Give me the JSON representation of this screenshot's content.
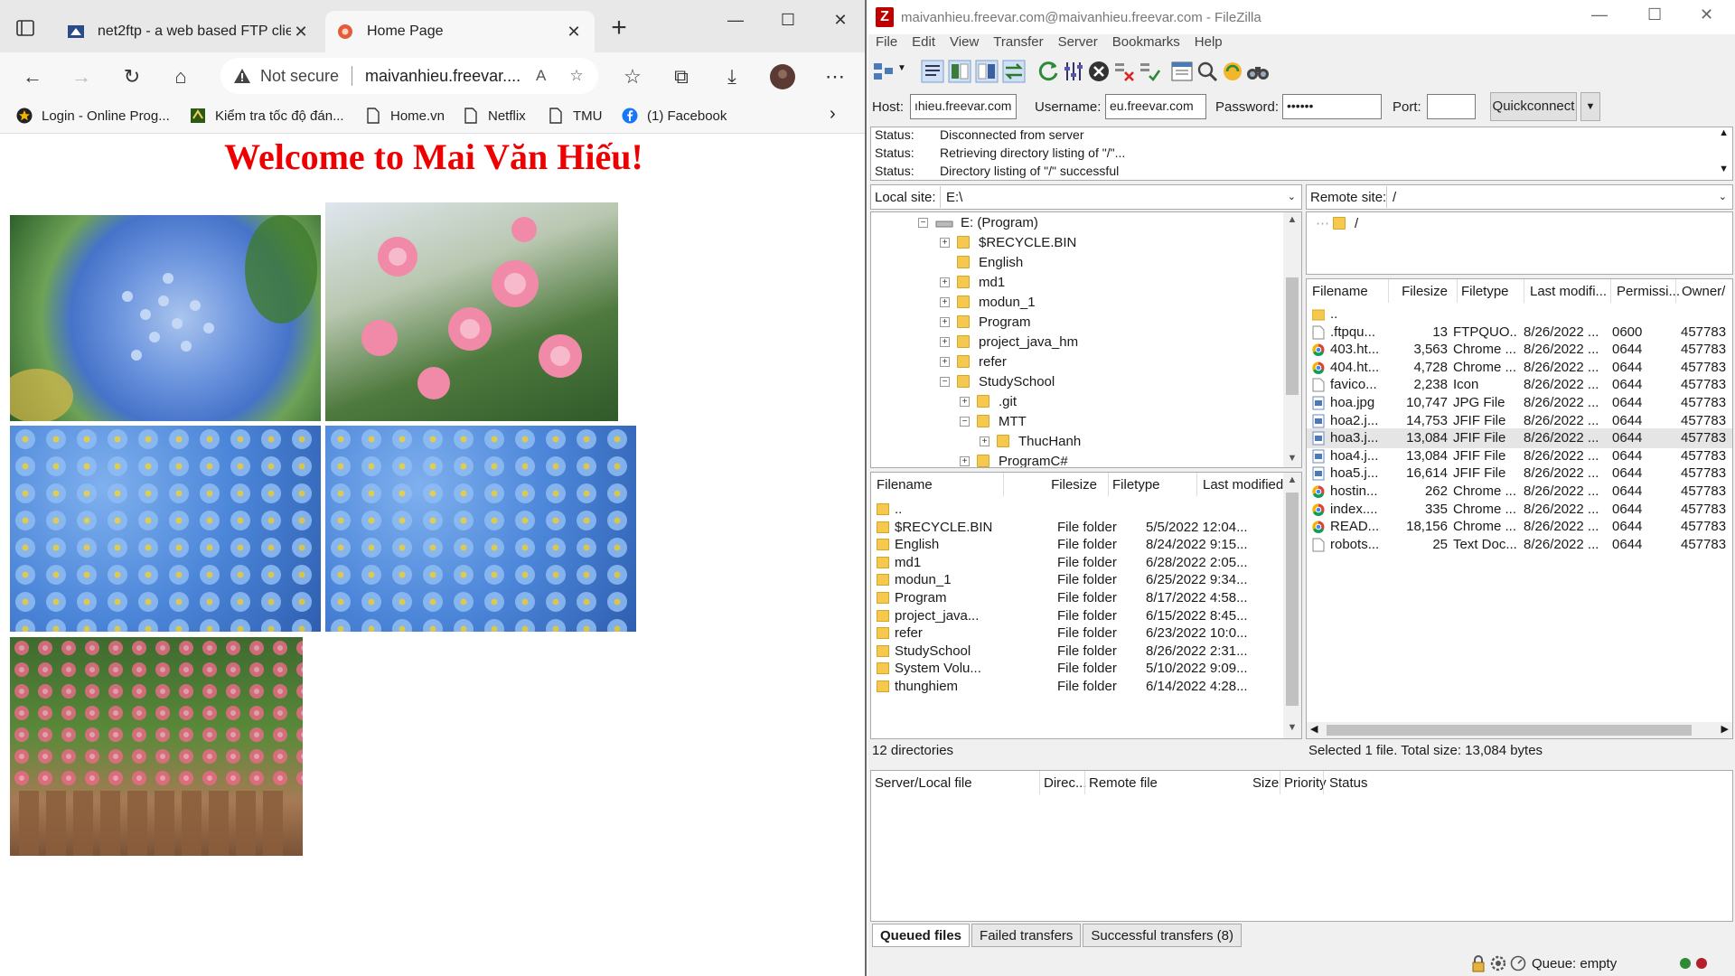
{
  "browser": {
    "tabs": [
      {
        "title": "net2ftp - a web based FTP client"
      },
      {
        "title": "Home Page"
      }
    ],
    "address": {
      "security": "Not secure",
      "url": "maivanhieu.freevar...."
    },
    "bookmarks": [
      {
        "label": "Login - Online Prog..."
      },
      {
        "label": "Kiểm tra tốc độ đán..."
      },
      {
        "label": "Home.vn"
      },
      {
        "label": "Netflix"
      },
      {
        "label": "TMU"
      },
      {
        "label": "(1) Facebook"
      }
    ],
    "page": {
      "heading": "Welcome to Mai Văn Hiếu!",
      "photos": [
        "hydrangea",
        "pink-roses",
        "forget-me-nots",
        "forget-me-nots",
        "climbing-roses"
      ]
    }
  },
  "filezilla": {
    "title": "maivanhieu.freevar.com@maivanhieu.freevar.com - FileZilla",
    "menu": [
      "File",
      "Edit",
      "View",
      "Transfer",
      "Server",
      "Bookmarks",
      "Help"
    ],
    "quickconnect": {
      "host_label": "Host:",
      "host_value": "ıhieu.freevar.com",
      "username_label": "Username:",
      "username_value": "eu.freevar.com",
      "password_label": "Password:",
      "password_value": "••••••",
      "port_label": "Port:",
      "port_value": "",
      "button": "Quickconnect"
    },
    "log": [
      {
        "label": "Status:",
        "msg": "Disconnected from server"
      },
      {
        "label": "Status:",
        "msg": "Retrieving directory listing of \"/\"..."
      },
      {
        "label": "Status:",
        "msg": "Directory listing of \"/\" successful"
      }
    ],
    "local_site": {
      "label": "Local site:",
      "value": "E:\\"
    },
    "remote_site": {
      "label": "Remote site:",
      "value": "/"
    },
    "local_tree": [
      {
        "label": "E: (Program)",
        "expander": "⊟"
      },
      {
        "label": "$RECYCLE.BIN",
        "expander": "+"
      },
      {
        "label": "English",
        "expander": ""
      },
      {
        "label": "md1",
        "expander": "+"
      },
      {
        "label": "modun_1",
        "expander": "+"
      },
      {
        "label": "Program",
        "expander": "+"
      },
      {
        "label": "project_java_hm",
        "expander": "+"
      },
      {
        "label": "refer",
        "expander": "+"
      },
      {
        "label": "StudySchool",
        "expander": "−"
      },
      {
        "label": ".git",
        "expander": "+"
      },
      {
        "label": "MTT",
        "expander": "−"
      },
      {
        "label": "ThucHanh",
        "expander": "+"
      },
      {
        "label": "ProgramC#",
        "expander": "+"
      }
    ],
    "remote_tree": [
      {
        "label": "/"
      }
    ],
    "local_columns": [
      "Filename",
      "Filesize",
      "Filetype",
      "Last modified"
    ],
    "local_files": [
      {
        "name": "..",
        "size": "",
        "type": "",
        "modified": ""
      },
      {
        "name": "$RECYCLE.BIN",
        "size": "",
        "type": "File folder",
        "modified": "5/5/2022 12:04..."
      },
      {
        "name": "English",
        "size": "",
        "type": "File folder",
        "modified": "8/24/2022 9:15..."
      },
      {
        "name": "md1",
        "size": "",
        "type": "File folder",
        "modified": "6/28/2022 2:05..."
      },
      {
        "name": "modun_1",
        "size": "",
        "type": "File folder",
        "modified": "6/25/2022 9:34..."
      },
      {
        "name": "Program",
        "size": "",
        "type": "File folder",
        "modified": "8/17/2022 4:58..."
      },
      {
        "name": "project_java...",
        "size": "",
        "type": "File folder",
        "modified": "6/15/2022 8:45..."
      },
      {
        "name": "refer",
        "size": "",
        "type": "File folder",
        "modified": "6/23/2022 10:0..."
      },
      {
        "name": "StudySchool",
        "size": "",
        "type": "File folder",
        "modified": "8/26/2022 2:31..."
      },
      {
        "name": "System Volu...",
        "size": "",
        "type": "File folder",
        "modified": "5/10/2022 9:09..."
      },
      {
        "name": "thunghiem",
        "size": "",
        "type": "File folder",
        "modified": "6/14/2022 4:28..."
      }
    ],
    "remote_columns": [
      "Filename",
      "Filesize",
      "Filetype",
      "Last modifi...",
      "Permissi...",
      "Owner/"
    ],
    "remote_files": [
      {
        "name": "..",
        "size": "",
        "type": "",
        "modified": "",
        "perm": "",
        "owner": "",
        "icon": "folder"
      },
      {
        "name": ".ftpqu...",
        "size": "13",
        "type": "FTPQUO...",
        "modified": "8/26/2022 ...",
        "perm": "0600",
        "owner": "457783",
        "icon": "file"
      },
      {
        "name": "403.ht...",
        "size": "3,563",
        "type": "Chrome ...",
        "modified": "8/26/2022 ...",
        "perm": "0644",
        "owner": "457783",
        "icon": "chrome"
      },
      {
        "name": "404.ht...",
        "size": "4,728",
        "type": "Chrome ...",
        "modified": "8/26/2022 ...",
        "perm": "0644",
        "owner": "457783",
        "icon": "chrome"
      },
      {
        "name": "favico...",
        "size": "2,238",
        "type": "Icon",
        "modified": "8/26/2022 ...",
        "perm": "0644",
        "owner": "457783",
        "icon": "file"
      },
      {
        "name": "hoa.jpg",
        "size": "10,747",
        "type": "JPG File",
        "modified": "8/26/2022 ...",
        "perm": "0644",
        "owner": "457783",
        "icon": "image"
      },
      {
        "name": "hoa2.j...",
        "size": "14,753",
        "type": "JFIF File",
        "modified": "8/26/2022 ...",
        "perm": "0644",
        "owner": "457783",
        "icon": "image"
      },
      {
        "name": "hoa3.j...",
        "size": "13,084",
        "type": "JFIF File",
        "modified": "8/26/2022 ...",
        "perm": "0644",
        "owner": "457783",
        "icon": "image",
        "selected": true
      },
      {
        "name": "hoa4.j...",
        "size": "13,084",
        "type": "JFIF File",
        "modified": "8/26/2022 ...",
        "perm": "0644",
        "owner": "457783",
        "icon": "image"
      },
      {
        "name": "hoa5.j...",
        "size": "16,614",
        "type": "JFIF File",
        "modified": "8/26/2022 ...",
        "perm": "0644",
        "owner": "457783",
        "icon": "image"
      },
      {
        "name": "hostin...",
        "size": "262",
        "type": "Chrome ...",
        "modified": "8/26/2022 ...",
        "perm": "0644",
        "owner": "457783",
        "icon": "chrome"
      },
      {
        "name": "index....",
        "size": "335",
        "type": "Chrome ...",
        "modified": "8/26/2022 ...",
        "perm": "0644",
        "owner": "457783",
        "icon": "chrome"
      },
      {
        "name": "READ...",
        "size": "18,156",
        "type": "Chrome ...",
        "modified": "8/26/2022 ...",
        "perm": "0644",
        "owner": "457783",
        "icon": "chrome"
      },
      {
        "name": "robots...",
        "size": "25",
        "type": "Text Doc...",
        "modified": "8/26/2022 ...",
        "perm": "0644",
        "owner": "457783",
        "icon": "file"
      }
    ],
    "local_status": "12 directories",
    "remote_status": "Selected 1 file. Total size: 13,084 bytes",
    "queue_columns": [
      "Server/Local file",
      "Direc...",
      "Remote file",
      "Size",
      "Priority",
      "Status"
    ],
    "queue_tabs": [
      "Queued files",
      "Failed transfers",
      "Successful transfers (8)"
    ],
    "queue_status": "Queue: empty"
  }
}
